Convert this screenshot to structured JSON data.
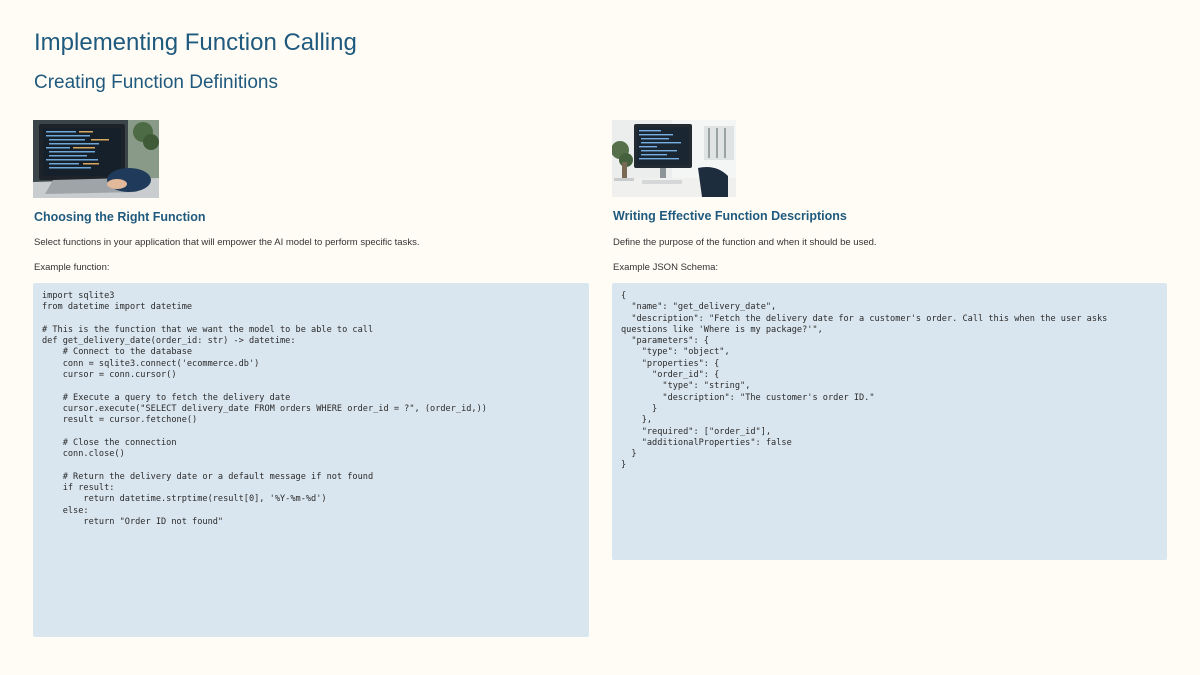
{
  "page": {
    "title": "Implementing Function Calling",
    "subtitle": "Creating Function Definitions"
  },
  "left": {
    "image_alt": "Person typing code on a laptop",
    "heading": "Choosing the Right Function",
    "description": "Select functions in your application that will empower the AI model to perform specific tasks.",
    "example_label": "Example function:",
    "code": "import sqlite3\nfrom datetime import datetime\n\n# This is the function that we want the model to be able to call\ndef get_delivery_date(order_id: str) -> datetime:\n    # Connect to the database\n    conn = sqlite3.connect('ecommerce.db')\n    cursor = conn.cursor()\n\n    # Execute a query to fetch the delivery date\n    cursor.execute(\"SELECT delivery_date FROM orders WHERE order_id = ?\", (order_id,))\n    result = cursor.fetchone()\n\n    # Close the connection\n    conn.close()\n\n    # Return the delivery date or a default message if not found\n    if result:\n        return datetime.strptime(result[0], '%Y-%m-%d')\n    else:\n        return \"Order ID not found\""
  },
  "right": {
    "image_alt": "Desk with monitor showing code",
    "heading": "Writing Effective Function Descriptions",
    "description": "Define the purpose of the function and when it should be used.",
    "example_label": "Example JSON Schema:",
    "code": "{\n  \"name\": \"get_delivery_date\",\n  \"description\": \"Fetch the delivery date for a customer's order. Call this when the user asks questions like 'Where is my package?'\",\n  \"parameters\": {\n    \"type\": \"object\",\n    \"properties\": {\n      \"order_id\": {\n        \"type\": \"string\",\n        \"description\": \"The customer's order ID.\"\n      }\n    },\n    \"required\": [\"order_id\"],\n    \"additionalProperties\": false\n  }\n}"
  },
  "colors": {
    "background": "#fffcf5",
    "heading": "#1f5a7e",
    "code_bg": "#dae6ef"
  }
}
